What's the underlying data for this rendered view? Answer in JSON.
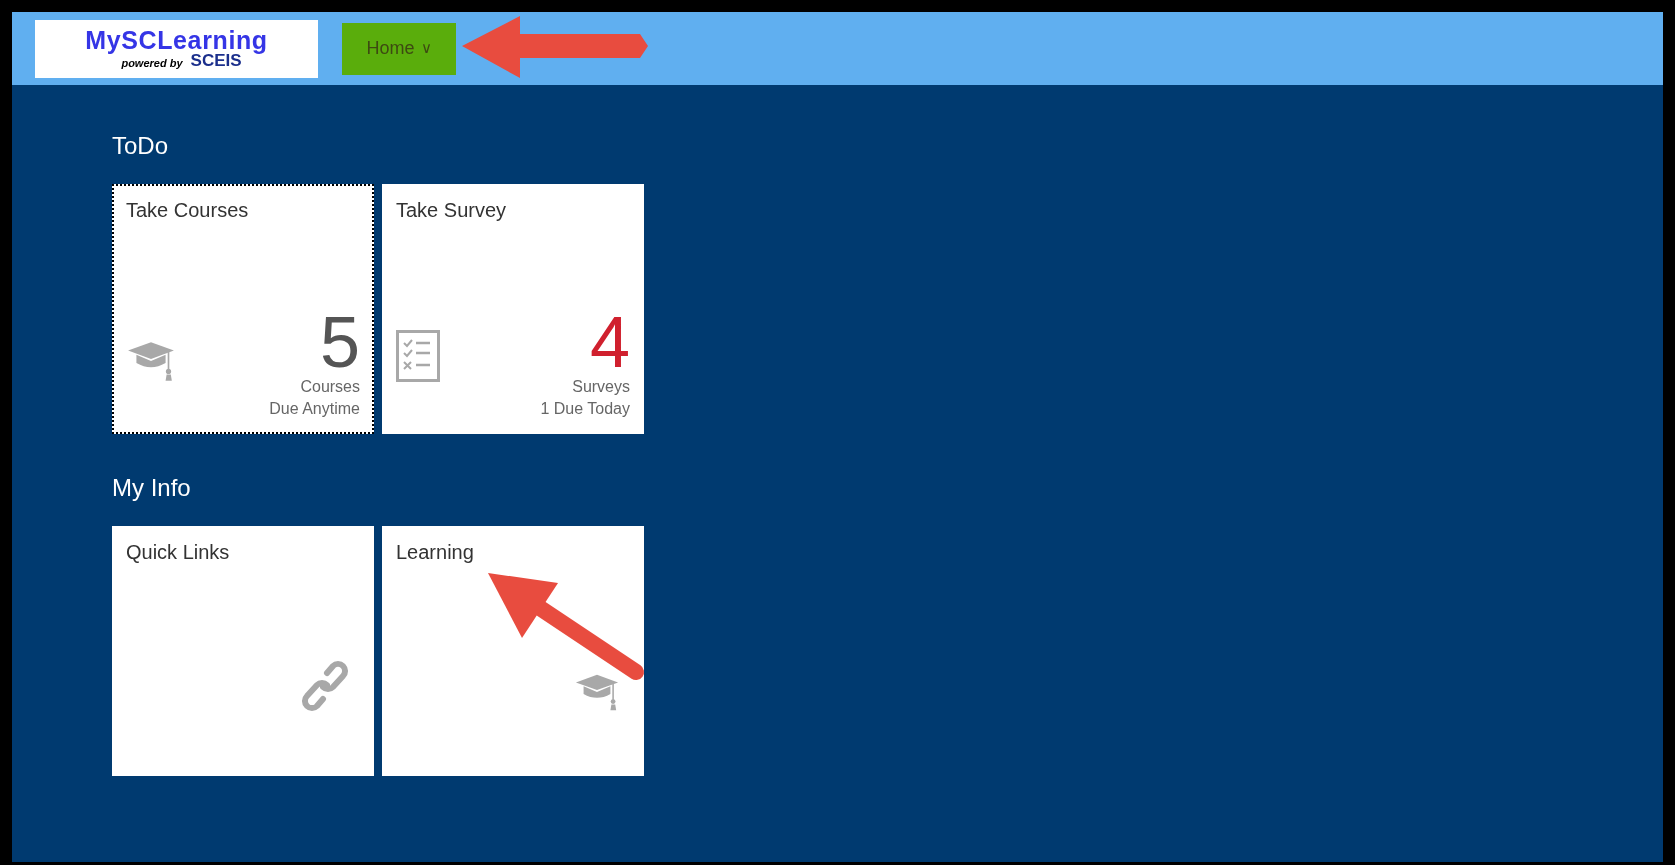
{
  "logo": {
    "title": "MySCLearning",
    "tagline": "powered by",
    "brand": "SCEIS"
  },
  "nav": {
    "label": "Home",
    "caret": "∨"
  },
  "sections": [
    {
      "title": "ToDo",
      "tiles": [
        {
          "kind": "courses",
          "title": "Take Courses",
          "focused": true,
          "count": "5",
          "color": "#555555",
          "unit": "Courses",
          "due": "Due Anytime"
        },
        {
          "kind": "survey",
          "title": "Take Survey",
          "focused": false,
          "count": "4",
          "color": "#d0202e",
          "unit": "Surveys",
          "due": "1 Due Today"
        }
      ]
    },
    {
      "title": "My Info",
      "tiles": [
        {
          "kind": "links",
          "title": "Quick Links",
          "focused": false
        },
        {
          "kind": "learning",
          "title": "Learning",
          "focused": false
        }
      ]
    }
  ]
}
